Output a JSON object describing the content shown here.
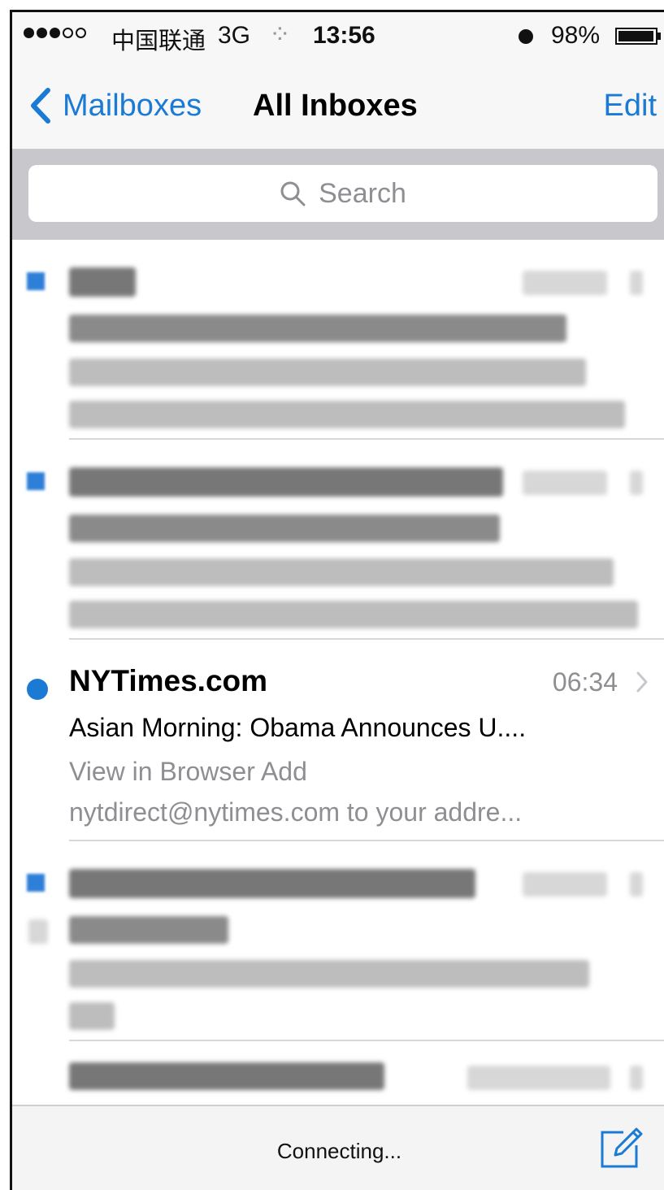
{
  "status_bar": {
    "carrier": "中国联通",
    "network": "3G",
    "time": "13:56",
    "battery": "98%"
  },
  "nav": {
    "back_label": "Mailboxes",
    "title": "All Inboxes",
    "edit_label": "Edit"
  },
  "search": {
    "placeholder": "Search"
  },
  "messages": {
    "visible": {
      "sender": "NYTimes.com",
      "time": "06:34",
      "subject": "Asian Morning: Obama Announces U....",
      "preview_line1": "View in Browser Add",
      "preview_line2": "nytdirect@nytimes.com to your addre..."
    }
  },
  "toolbar": {
    "status": "Connecting..."
  },
  "colors": {
    "accent": "#1a7ad4",
    "background": "#f7f7f7",
    "search_bar": "#c8c8cc"
  },
  "icons": {
    "back": "chevron-left-icon",
    "search": "search-icon",
    "chevron": "chevron-right-icon",
    "compose": "compose-icon",
    "alarm": "alarm-icon",
    "battery": "battery-icon"
  }
}
